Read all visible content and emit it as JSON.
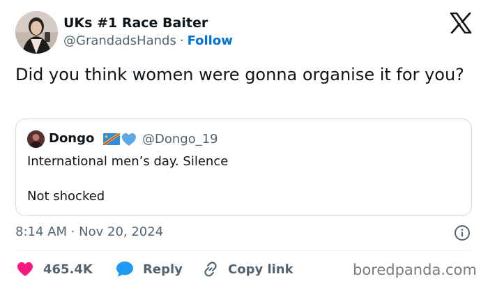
{
  "author": {
    "name": "UKs #1 Race Baiter",
    "handle": "@GrandadsHands",
    "separator": "·",
    "follow_label": "Follow"
  },
  "tweet": {
    "text": "Did you think women were gonna organise it for you?"
  },
  "quoted_tweet": {
    "name": "Dongo",
    "handle": "@Dongo_19",
    "line1": "International men’s day. Silence",
    "line2": "Not shocked"
  },
  "meta": {
    "timestamp": "8:14 AM · Nov 20, 2024"
  },
  "actions": {
    "like_count": "465.4K",
    "reply_label": "Reply",
    "copy_label": "Copy link"
  },
  "watermark": "boredpanda.com",
  "icons": {
    "logo": "x-logo-icon",
    "info": "info-icon",
    "like": "heart-icon",
    "reply": "speech-bubble-icon",
    "copy": "link-icon",
    "flag": "dr-congo-flag-icon",
    "badge": "blue-heart-icon"
  },
  "colors": {
    "follow": "#0074d4",
    "like": "#f91880",
    "reply": "#1d9bf0",
    "muted": "#536471",
    "border": "#cfd9de"
  }
}
